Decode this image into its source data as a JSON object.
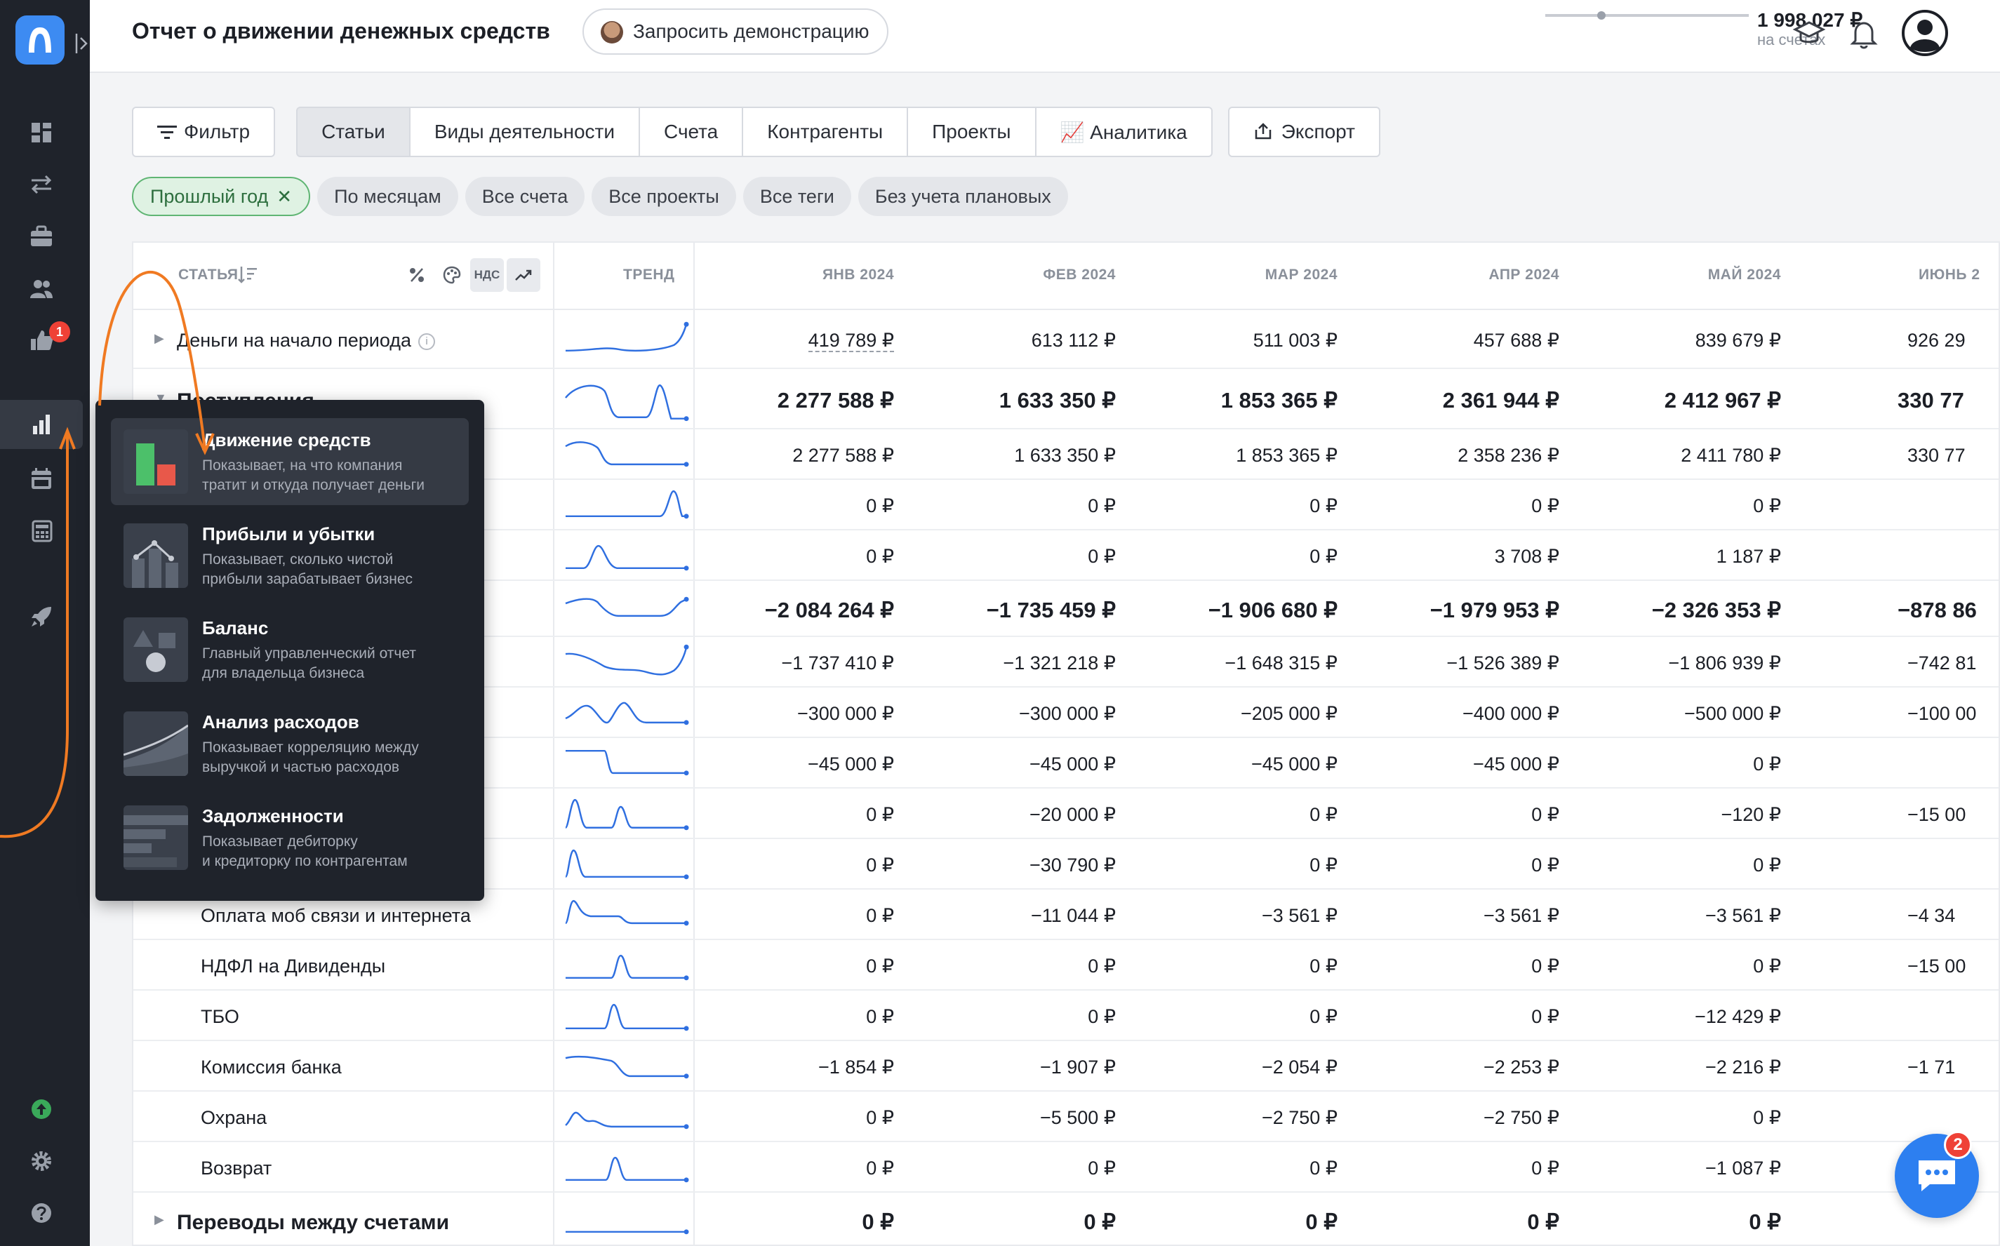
{
  "header": {
    "title": "Отчет о движении денежных средств",
    "demo_button": "Запросить демонстрацию",
    "balance_amount": "1 998 027 ₽",
    "balance_caption": "на счетах"
  },
  "sidebar": {
    "items": [
      {
        "icon": "dashboard-icon"
      },
      {
        "icon": "transfers-icon"
      },
      {
        "icon": "briefcase-icon"
      },
      {
        "icon": "users-icon"
      },
      {
        "icon": "thumb-up-icon",
        "badge": "1"
      },
      {
        "icon": "reports-chart-icon",
        "active": true
      },
      {
        "icon": "calendar-icon"
      },
      {
        "icon": "calculator-icon"
      },
      {
        "icon": "rocket-icon"
      },
      {
        "icon": "upgrade-icon"
      },
      {
        "icon": "settings-icon"
      },
      {
        "icon": "help-icon"
      }
    ]
  },
  "toolbar": {
    "filter": "Фильтр",
    "tabs": [
      "Статьи",
      "Виды деятельности",
      "Счета",
      "Контрагенты",
      "Проекты",
      "📈 Аналитика"
    ],
    "active_tab": "Статьи",
    "export": "Экспорт"
  },
  "chips": {
    "period": "Прошлый год",
    "items": [
      "По месяцам",
      "Все счета",
      "Все проекты",
      "Все теги",
      "Без учета плановых"
    ]
  },
  "table": {
    "headers": {
      "article": "СТАТЬЯ",
      "vat": "НДС",
      "trend": "ТРЕНД",
      "months": [
        "ЯНВ 2024",
        "ФЕВ 2024",
        "МАР 2024",
        "АПР 2024",
        "МАЙ 2024",
        "ИЮНЬ 2"
      ]
    },
    "rows": [
      {
        "name": "Деньги на начало периода",
        "values": [
          "419 789 ₽",
          "613 112 ₽",
          "511 003 ₽",
          "457 688 ₽",
          "839 679 ₽",
          "926 29"
        ]
      },
      {
        "name": "Поступления",
        "values": [
          "2 277 588 ₽",
          "1 633 350 ₽",
          "1 853 365 ₽",
          "2 361 944 ₽",
          "2 412 967 ₽",
          "330 77"
        ]
      },
      {
        "name": "",
        "values": [
          "2 277 588 ₽",
          "1 633 350 ₽",
          "1 853 365 ₽",
          "2 358 236 ₽",
          "2 411 780 ₽",
          "330 77"
        ]
      },
      {
        "name": "",
        "values": [
          "0 ₽",
          "0 ₽",
          "0 ₽",
          "0 ₽",
          "0 ₽",
          ""
        ]
      },
      {
        "name": "",
        "values": [
          "0 ₽",
          "0 ₽",
          "0 ₽",
          "3 708 ₽",
          "1 187 ₽",
          ""
        ]
      },
      {
        "name": "",
        "values": [
          "−2 084 264 ₽",
          "−1 735 459 ₽",
          "−1 906 680 ₽",
          "−1 979 953 ₽",
          "−2 326 353 ₽",
          "−878 86"
        ]
      },
      {
        "name": "",
        "values": [
          "−1 737 410 ₽",
          "−1 321 218 ₽",
          "−1 648 315 ₽",
          "−1 526 389 ₽",
          "−1 806 939 ₽",
          "−742 81"
        ]
      },
      {
        "name": "",
        "values": [
          "−300 000 ₽",
          "−300 000 ₽",
          "−205 000 ₽",
          "−400 000 ₽",
          "−500 000 ₽",
          "−100 00"
        ]
      },
      {
        "name": "",
        "values": [
          "−45 000 ₽",
          "−45 000 ₽",
          "−45 000 ₽",
          "−45 000 ₽",
          "0 ₽",
          ""
        ]
      },
      {
        "name": "",
        "values": [
          "0 ₽",
          "−20 000 ₽",
          "0 ₽",
          "0 ₽",
          "−120 ₽",
          "−15 00"
        ]
      },
      {
        "name": "",
        "values": [
          "0 ₽",
          "−30 790 ₽",
          "0 ₽",
          "0 ₽",
          "0 ₽",
          ""
        ]
      },
      {
        "name": "Оплата моб связи и интернета",
        "values": [
          "0 ₽",
          "−11 044 ₽",
          "−3 561 ₽",
          "−3 561 ₽",
          "−3 561 ₽",
          "−4 34"
        ]
      },
      {
        "name": "НДФЛ на Дивиденды",
        "values": [
          "0 ₽",
          "0 ₽",
          "0 ₽",
          "0 ₽",
          "0 ₽",
          "−15 00"
        ]
      },
      {
        "name": "ТБО",
        "values": [
          "0 ₽",
          "0 ₽",
          "0 ₽",
          "0 ₽",
          "−12 429 ₽",
          ""
        ]
      },
      {
        "name": "Комиссия банка",
        "values": [
          "−1 854 ₽",
          "−1 907 ₽",
          "−2 054 ₽",
          "−2 253 ₽",
          "−2 216 ₽",
          "−1 71"
        ]
      },
      {
        "name": "Охрана",
        "values": [
          "0 ₽",
          "−5 500 ₽",
          "−2 750 ₽",
          "−2 750 ₽",
          "0 ₽",
          ""
        ]
      },
      {
        "name": "Возврат",
        "values": [
          "0 ₽",
          "0 ₽",
          "0 ₽",
          "0 ₽",
          "−1 087 ₽",
          ""
        ]
      },
      {
        "name": "Переводы между счетами",
        "values": [
          "0 ₽",
          "0 ₽",
          "0 ₽",
          "0 ₽",
          "0 ₽",
          ""
        ]
      }
    ]
  },
  "reports_menu": {
    "items": [
      {
        "title": "Движение средств",
        "desc1": "Показывает, на что компания",
        "desc2": "тратит и откуда получает деньги"
      },
      {
        "title": "Прибыли и убытки",
        "desc1": "Показывает, сколько чистой",
        "desc2": "прибыли зарабатывает бизнес"
      },
      {
        "title": "Баланс",
        "desc1": "Главный управленческий отчет",
        "desc2": "для владельца бизнеса"
      },
      {
        "title": "Анализ расходов",
        "desc1": "Показывает корреляцию между",
        "desc2": "выручкой и частью расходов"
      },
      {
        "title": "Задолженности",
        "desc1": "Показывает дебиторку",
        "desc2": "и кредиторку по контрагентам"
      }
    ]
  },
  "chat": {
    "badge": "2"
  },
  "colors": {
    "sidebar": "#1f232b",
    "accent_blue": "#2d7ff0",
    "spark_blue": "#2f6fe0",
    "annotation_orange": "#f07a22",
    "badge_red": "#ef4136"
  }
}
